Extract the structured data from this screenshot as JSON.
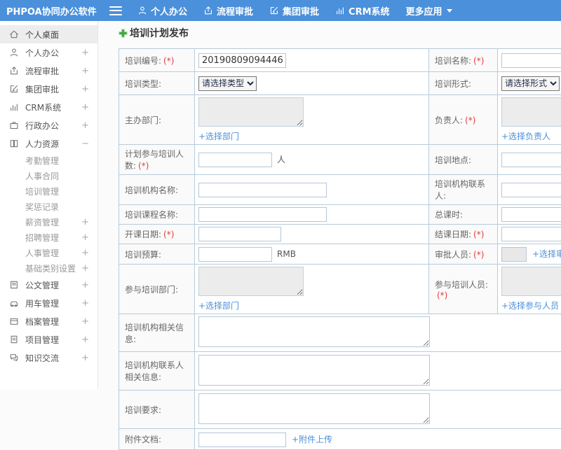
{
  "app": {
    "brand": "PHPOA协同办公软件"
  },
  "header": {
    "nav": [
      {
        "label": "个人办公"
      },
      {
        "label": "流程审批"
      },
      {
        "label": "集团审批"
      },
      {
        "label": "CRM系统"
      },
      {
        "label": "更多应用"
      }
    ]
  },
  "sidebar": {
    "items": [
      {
        "label": "个人桌面"
      },
      {
        "label": "个人办公",
        "expand": "+"
      },
      {
        "label": "流程审批",
        "expand": "+"
      },
      {
        "label": "集团审批",
        "expand": "+"
      },
      {
        "label": "CRM系统",
        "expand": "+"
      },
      {
        "label": "行政办公",
        "expand": "+"
      },
      {
        "label": "人力资源",
        "expand": "−"
      },
      {
        "label": "考勤管理"
      },
      {
        "label": "人事合同"
      },
      {
        "label": "培训管理"
      },
      {
        "label": "奖惩记录"
      },
      {
        "label": "薪资管理",
        "expand": "+"
      },
      {
        "label": "招聘管理",
        "expand": "+"
      },
      {
        "label": "人事管理",
        "expand": "+"
      },
      {
        "label": "基础类别设置",
        "expand": "+"
      },
      {
        "label": "公文管理",
        "expand": "+"
      },
      {
        "label": "用车管理",
        "expand": "+"
      },
      {
        "label": "档案管理",
        "expand": "+"
      },
      {
        "label": "项目管理",
        "expand": "+"
      },
      {
        "label": "知识交流",
        "expand": "+"
      }
    ]
  },
  "page": {
    "title": "培训计划发布"
  },
  "form": {
    "required_mark": "(*)",
    "number": {
      "label": "培训编号:",
      "value": "20190809094446"
    },
    "name": {
      "label": "培训名称:"
    },
    "type": {
      "label": "培训类型:",
      "selected": "请选择类型"
    },
    "mode": {
      "label": "培训形式:",
      "selected": "请选择形式"
    },
    "host_dept": {
      "label": "主办部门:",
      "link": "+选择部门"
    },
    "leader": {
      "label": "负责人:",
      "link": "+选择负责人"
    },
    "planned_count": {
      "label": "计划参与培训人数:",
      "suffix": "人"
    },
    "location": {
      "label": "培训地点:"
    },
    "org_name": {
      "label": "培训机构名称:"
    },
    "org_contact": {
      "label": "培训机构联系人:"
    },
    "course_name": {
      "label": "培训课程名称:"
    },
    "total_hours": {
      "label": "总课时:"
    },
    "start_date": {
      "label": "开课日期:"
    },
    "end_date": {
      "label": "结课日期:"
    },
    "budget": {
      "label": "培训预算:",
      "suffix": "RMB"
    },
    "approver": {
      "label": "审批人员:",
      "link": "+选择审批人员"
    },
    "join_depts": {
      "label": "参与培训部门:",
      "link": "+选择部门"
    },
    "join_people": {
      "label": "参与培训人员:",
      "link": "+选择参与人员"
    },
    "org_info": {
      "label": "培训机构相关信息:"
    },
    "org_contact_info": {
      "label": "培训机构联系人相关信息:"
    },
    "requirements": {
      "label": "培训要求:"
    },
    "attachment": {
      "label": "附件文档:",
      "link": "+附件上传"
    }
  },
  "colors": {
    "header_bg": "#4a90db",
    "link_blue": "#4a90d9",
    "required_red": "#e53b3b",
    "accent_green": "#3fa53f"
  }
}
